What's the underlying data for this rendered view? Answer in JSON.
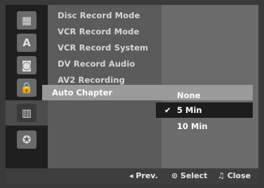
{
  "menu": {
    "items": [
      "Disc Record Mode",
      "VCR Record Mode",
      "VCR Record System",
      "DV Record Audio",
      "AV2 Recording"
    ],
    "selected": "Auto Chapter"
  },
  "submenu": {
    "options": [
      "None",
      "5 Min",
      "10 Min"
    ],
    "selected_index": 1,
    "check": "✔"
  },
  "icons": [
    "disc-icon",
    "language-icon",
    "audio-icon",
    "lock-icon",
    "film-icon",
    "settings-disc-icon"
  ],
  "footer": {
    "prev": "◂ Prev.",
    "select": "⊙ Select",
    "close": "♫ Close"
  }
}
